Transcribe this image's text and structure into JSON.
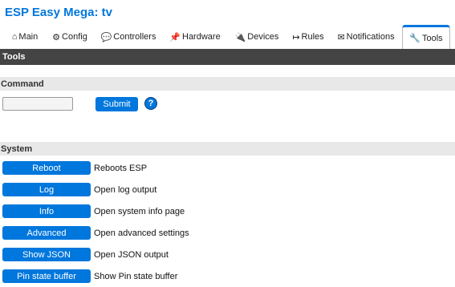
{
  "app": {
    "title": "ESP Easy Mega: tv"
  },
  "tabs": [
    {
      "label": "Main",
      "icon": "⌂"
    },
    {
      "label": "Config",
      "icon": "⚙"
    },
    {
      "label": "Controllers",
      "icon": "💬"
    },
    {
      "label": "Hardware",
      "icon": "📌"
    },
    {
      "label": "Devices",
      "icon": "🔌"
    },
    {
      "label": "Rules",
      "icon": "↦"
    },
    {
      "label": "Notifications",
      "icon": "✉"
    },
    {
      "label": "Tools",
      "icon": "🔧",
      "active": true
    }
  ],
  "page": {
    "title": "Tools"
  },
  "command": {
    "header": "Command",
    "input_value": "",
    "submit_label": "Submit",
    "help_glyph": "?"
  },
  "system": {
    "header": "System",
    "items": [
      {
        "button": "Reboot",
        "description": "Reboots ESP"
      },
      {
        "button": "Log",
        "description": "Open log output"
      },
      {
        "button": "Info",
        "description": "Open system info page"
      },
      {
        "button": "Advanced",
        "description": "Open advanced settings"
      },
      {
        "button": "Show JSON",
        "description": "Open JSON output"
      },
      {
        "button": "Pin state buffer",
        "description": "Show Pin state buffer"
      }
    ]
  },
  "colors": {
    "accent": "#0077dd",
    "header_bar": "#444444",
    "section_bg": "#e8e8e8"
  }
}
